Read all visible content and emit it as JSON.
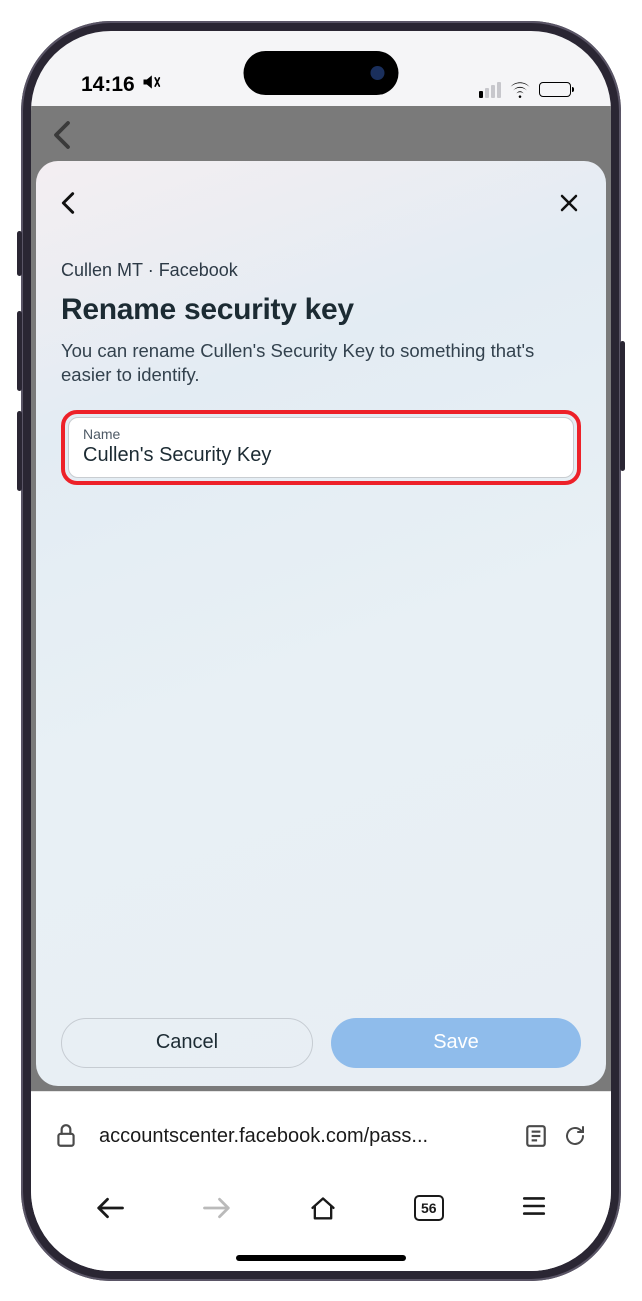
{
  "status": {
    "time": "14:16"
  },
  "card": {
    "breadcrumb": "Cullen MT · Facebook",
    "title": "Rename security key",
    "description": "You can rename Cullen's Security Key to something that's easier to identify.",
    "field_label": "Name",
    "field_value": "Cullen's Security Key",
    "cancel_label": "Cancel",
    "save_label": "Save"
  },
  "browser": {
    "url": "accountscenter.facebook.com/pass...",
    "tab_count": "56"
  }
}
